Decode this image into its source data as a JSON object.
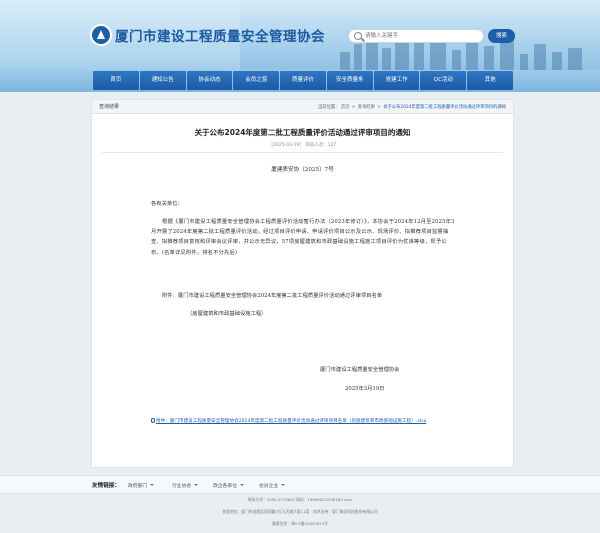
{
  "header": {
    "site_title": "厦门市建设工程质量安全管理协会",
    "search_placeholder": "请输入关键字",
    "search_button": "搜索"
  },
  "nav": [
    {
      "label": "首页"
    },
    {
      "label": "通知公告"
    },
    {
      "label": "协会动态"
    },
    {
      "label": "会员之窗"
    },
    {
      "label": "质量评价"
    },
    {
      "label": "安全质量条"
    },
    {
      "label": "党建工作"
    },
    {
      "label": "QC活动"
    },
    {
      "label": "其他"
    }
  ],
  "breadcrumb": {
    "section": "查询结果",
    "prefix": "当前位置：",
    "items": [
      "首页",
      "查询结果",
      "关于公布2024年度第二批工程质量评价活动通过评审项目的通知"
    ]
  },
  "article": {
    "title": "关于公布2024年度第二批工程质量评价活动通过评审项目的通知",
    "meta": "［2025-03-19］ 浏览人次：127",
    "doc_no": "厦建质安协〔2025〕7号",
    "addressee": "各有关单位：",
    "paragraph": "根据《厦门市建设工程质量安全管理协会工程质量评价活动暂行办法（2023年修订）》，本协会于2024年12月至2025年3月开展了2024年度第二批工程质量评价活动。经过项目评价申请、申请评价项目公示及公示、现场评价、拟推荐项目监督抽查、拟推荐项目复核和评审会议评审，并公示无异议，57项房屋建筑和市政基础设施工程施工项目评价为优良等级，现予公布。(名单详见附件，排名不分先后)",
    "attachment": "附件：厦门市建设工程质量安全管理协会2024年度第二批工程质量评价活动通过评审项目名单",
    "attachment_sub": "（房屋建筑和市政基础设施工程）",
    "signature_org": "厦门市建设工程质量安全管理协会",
    "signature_date": "2025年3月19日",
    "file_link": "附件：厦门市建设工程质量安全管理协会2024年度第二批工程质量评价活动通过评审项目名单（房屋建筑和市政基础设施工程）.xlsx"
  },
  "links": {
    "label": "友情链接：",
    "groups": [
      "政府部门",
      "行业协会",
      "政企各单位",
      "会员企业"
    ]
  },
  "footer": {
    "line1": "联系方式：0592-2275602 网站：1869602325@163.com",
    "line2": "协会地址：厦门市湖里区园顶路3号九天湖大厦11层　技术支持：厦门海迈科技股份有限公司",
    "line3": "备案信息：闽ICP备10007613号"
  },
  "colors": {
    "primary": "#1d5eab",
    "nav": "#2f77c3",
    "background": "#e9eef3"
  }
}
